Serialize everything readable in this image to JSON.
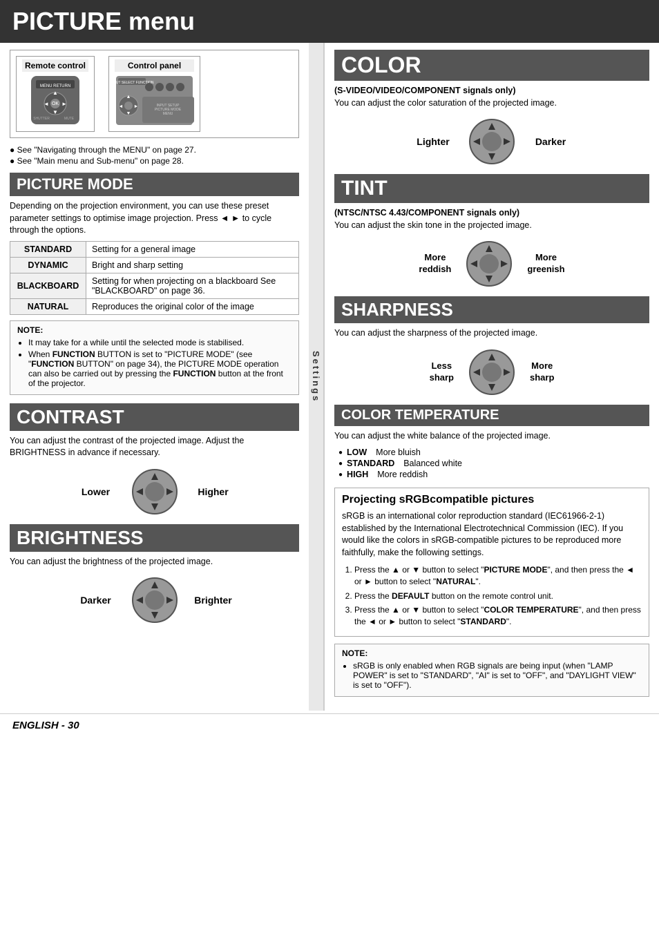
{
  "page": {
    "title": "PICTURE menu",
    "footer": "ENGLISH - 30"
  },
  "remote": {
    "label": "Remote control",
    "panel_label": "Control panel",
    "note1": "● See \"Navigating through the MENU\" on page 27.",
    "note2": "● See \"Main menu and Sub-menu\" on page 28."
  },
  "picture_mode": {
    "header": "PICTURE MODE",
    "intro": "Depending on the projection environment, you can use these preset parameter settings to optimise image projection. Press ◄ ► to cycle through the options.",
    "rows": [
      {
        "mode": "STANDARD",
        "desc": "Setting for a general image"
      },
      {
        "mode": "DYNAMIC",
        "desc": "Bright and sharp setting"
      },
      {
        "mode": "BLACKBOARD",
        "desc": "Setting for when projecting on a blackboard\nSee \"BLACKBOARD\" on page 36."
      },
      {
        "mode": "NATURAL",
        "desc": "Reproduces the original color of the image"
      }
    ],
    "note_title": "NOTE:",
    "note_items": [
      "It may take for a while until the selected mode is stabilised.",
      "When FUNCTION BUTTON is set to \"PICTURE MODE\" (see \"FUNCTION BUTTON\" on page 34), the PICTURE MODE operation can also be carried out by pressing the FUNCTION button at the front of the projector."
    ]
  },
  "contrast": {
    "header": "CONTRAST",
    "body": "You can adjust the contrast of the projected image. Adjust the BRIGHTNESS in advance if necessary.",
    "left_label": "Lower",
    "right_label": "Higher"
  },
  "brightness": {
    "header": "BRIGHTNESS",
    "body": "You can adjust the brightness of the projected image.",
    "left_label": "Darker",
    "right_label": "Brighter"
  },
  "sidebar_label": "Settings",
  "color": {
    "header": "COLOR",
    "body_bold": "(S-VIDEO/VIDEO/COMPONENT signals only)",
    "body": "You can adjust the color saturation of the projected image.",
    "left_label": "Lighter",
    "right_label": "Darker"
  },
  "tint": {
    "header": "TINT",
    "body_bold": "(NTSC/NTSC 4.43/COMPONENT signals only)",
    "body": "You can adjust the skin tone in the projected image.",
    "left_label1": "More",
    "left_label2": "reddish",
    "right_label1": "More",
    "right_label2": "greenish"
  },
  "sharpness": {
    "header": "SHARPNESS",
    "body": "You can adjust the sharpness of the projected image.",
    "left_label1": "Less",
    "left_label2": "sharp",
    "right_label1": "More",
    "right_label2": "sharp"
  },
  "color_temp": {
    "header": "COLOR TEMPERATURE",
    "body": "You can adjust the white balance of the projected image.",
    "items": [
      {
        "label": "LOW",
        "desc": "More bluish"
      },
      {
        "label": "STANDARD",
        "desc": "Balanced white"
      },
      {
        "label": "HIGH",
        "desc": "More reddish"
      }
    ]
  },
  "srgb": {
    "title": "Projecting sRGBcompatible pictures",
    "body": "sRGB is an international color reproduction standard (IEC61966-2-1) established by the International Electrotechnical Commission (IEC).\nIf you would like the colors in sRGB-compatible pictures to be reproduced more faithfully, make the following settings.",
    "steps": [
      "Press the ▲ or ▼ button to select \"PICTURE MODE\", and then press the ◄ or ► button to select \"NATURAL\".",
      "Press the DEFAULT button on the remote control unit.",
      "Press the ▲ or ▼ button to select \"COLOR TEMPERATURE\", and then press the ◄ or ► button to select \"STANDARD\"."
    ]
  },
  "srgb_note": {
    "title": "NOTE:",
    "text": "sRGB is only enabled when RGB signals are being input (when \"LAMP POWER\" is set to \"STANDARD\", \"AI\" is set to \"OFF\", and \"DAYLIGHT VIEW\" is set to \"OFF\")."
  }
}
